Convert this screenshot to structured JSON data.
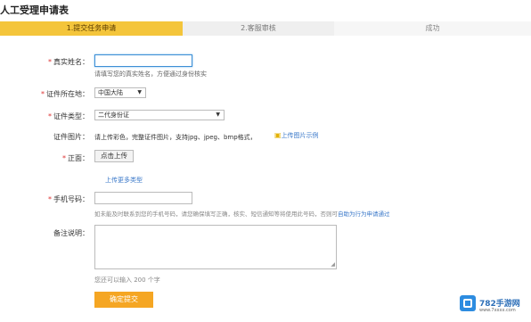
{
  "page": {
    "title": "人工受理申请表"
  },
  "steps": [
    {
      "label": "1.提交任务申请",
      "state": "active"
    },
    {
      "label": "2.客服审核",
      "state": "pending"
    },
    {
      "label": "成功",
      "state": "pending"
    }
  ],
  "form": {
    "real_name": {
      "label": "真实姓名：",
      "value": "",
      "hint": "请填写您的真实姓名，方便通过身份核实"
    },
    "id_region": {
      "label": "证件所在地：",
      "selected": "中国大陆"
    },
    "id_type": {
      "label": "证件类型：",
      "selected": "二代身份证"
    },
    "id_photo": {
      "label": "证件图片：",
      "desc": "请上传彩色，完整证件图片，支持jpg、jpeg、bmp格式，",
      "sample_link": "上传图片示例",
      "front_label": "正面：",
      "upload_button": "点击上传",
      "more_link": "上传更多类型"
    },
    "phone": {
      "label": "手机号码：",
      "value": "",
      "hint_prefix": "如未能及时联系到您的手机号码，请您确保填写正确，核实、短信通知等将使用此号码，否则可",
      "hint_link": "自助为行为申请通过"
    },
    "remark": {
      "label": "备注说明：",
      "value": "",
      "counter": "您还可以输入 200 个字"
    },
    "submit_label": "确定提交"
  },
  "watermark": {
    "brand": "782手游网",
    "sub": "www.7xxxx.com"
  },
  "colors": {
    "accent": "#f4c53b",
    "submit": "#f5a623",
    "link": "#3a78c9",
    "required": "#dd3333"
  }
}
